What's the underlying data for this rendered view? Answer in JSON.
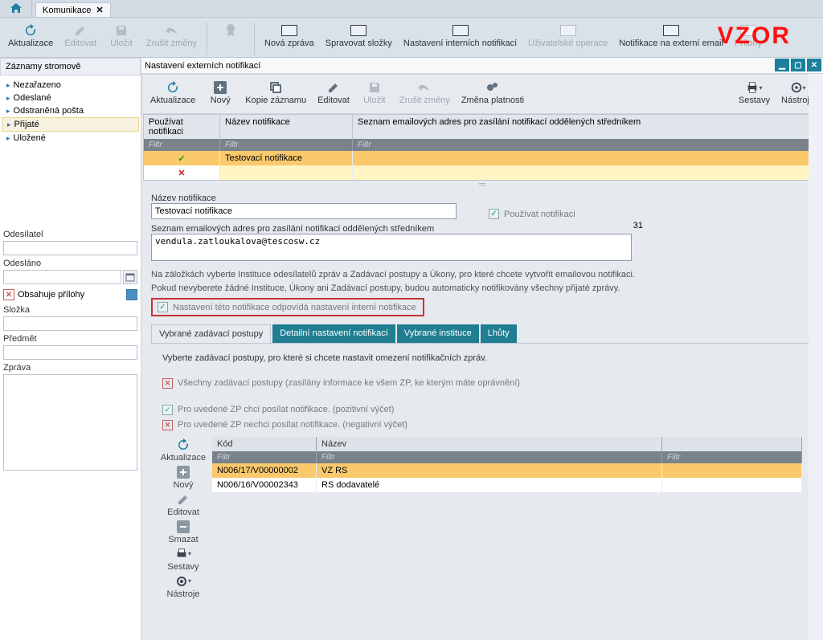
{
  "app": {
    "tab_label": "Komunikace",
    "watermark": "VZOR"
  },
  "toolbar": {
    "aktualizace": "Aktualizace",
    "editovat": "Editovat",
    "ulozit": "Uložit",
    "zrusit": "Zrušit změny",
    "nova_zprava": "Nová zpráva",
    "spravovat": "Spravovat složky",
    "interni_notif": "Nastavení interních notifikací",
    "uziv_op": "Uživatelské operace",
    "ext_notif": "Notifikace na externí email",
    "prilohy": "Přílohy"
  },
  "tree": {
    "title": "Záznamy stromově",
    "items": [
      "Nezařazeno",
      "Odeslané",
      "Odstraněná pošta",
      "Přijaté",
      "Uložené"
    ],
    "active_index": 3
  },
  "side": {
    "odesilatel": "Odesílatel",
    "odeslano": "Odesláno",
    "obsahuje": "Obsahuje přílohy",
    "slozka": "Složka",
    "predmet": "Předmět",
    "zprava": "Zpráva"
  },
  "panel": {
    "title": "Nastavení externích notifikací"
  },
  "subtoolbar": {
    "aktualizace": "Aktualizace",
    "novy": "Nový",
    "kopie": "Kopie záznamu",
    "editovat": "Editovat",
    "ulozit": "Uložit",
    "zrusit": "Zrušit změny",
    "zmena": "Změna platnosti",
    "sestavy": "Sestavy",
    "nastroje": "Nástroje"
  },
  "grid": {
    "col1": "Používat notifikaci",
    "col2": "Název notifikace",
    "col3": "Seznam emailových adres pro zasílání notifikací oddělených středníkem",
    "filter": "Filtr",
    "rows": [
      {
        "use": "check",
        "name": "Testovací notifikace",
        "emails": ""
      },
      {
        "use": "x",
        "name": "",
        "emails": ""
      }
    ]
  },
  "form": {
    "nazev_lbl": "Název notifikace",
    "nazev_val": "Testovací notifikace",
    "pouzivat": "Používat notifikaci",
    "emails_lbl": "Seznam emailových adres pro zasílání notifikací oddělených středníkem",
    "emails_val": "vendula.zatloukalova@tescosw.cz",
    "count": "31",
    "help1": "Na záložkách vyberte Instituce odesílatelů zpráv a Zadávací postupy a Úkony, pro které chcete vytvořit emailovou notifikaci.",
    "help2": "Pokud nevyberete žádné Instituce, Úkony ani Zadávací postupy, budou automaticky notifikovány všechny přijaté zprávy.",
    "red_chk": "Nastavení této notifikace odpovídá nastavení interní notifikace"
  },
  "tabs2": {
    "t1": "Vybrané zadávací postupy",
    "t2": "Detailní nastavení notifikací",
    "t3": "Vybrané instituce",
    "t4": "Lhůty"
  },
  "tabbody": {
    "intro": "Vyberte zadávací postupy, pro které si chcete nastavit omezení notifikačních zpráv.",
    "opt1": "Všechny zadávací postupy (zasílány informace ke všem ZP, ke kterým máte oprávnění)",
    "opt2": "Pro uvedené ZP chci posílat notifikace. (pozitivní výčet)",
    "opt3": "Pro uvedené ZP nechci posílat notifikace. (negativní výčet)"
  },
  "sideactions": {
    "aktualizace": "Aktualizace",
    "novy": "Nový",
    "editovat": "Editovat",
    "smazat": "Smazat",
    "sestavy": "Sestavy",
    "nastroje": "Nástroje"
  },
  "subgrid": {
    "col1": "Kód",
    "col2": "Název",
    "filter": "Filtr",
    "rows": [
      {
        "kod": "N006/17/V00000002",
        "nazev": "VZ RS"
      },
      {
        "kod": "N006/16/V00002343",
        "nazev": "RS dodavatelé"
      }
    ]
  }
}
